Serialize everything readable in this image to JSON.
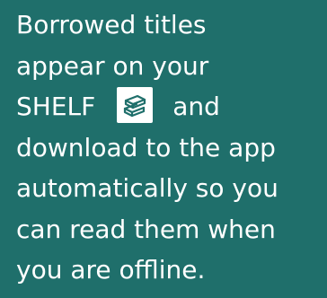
{
  "message": {
    "line1": "Borrowed titles",
    "line2": "appear on your",
    "line3_before_icon": "SHELF",
    "line3_after_icon": "and",
    "line4": "download to the app",
    "line5": "automatically so you",
    "line6": "can read them when",
    "line7": "you are offline."
  },
  "icon": {
    "name": "book-stack-icon",
    "stroke_color": "#1f6f6b",
    "background_color": "#ffffff"
  },
  "colors": {
    "background": "#1f6f6b",
    "text": "#ffffff"
  }
}
